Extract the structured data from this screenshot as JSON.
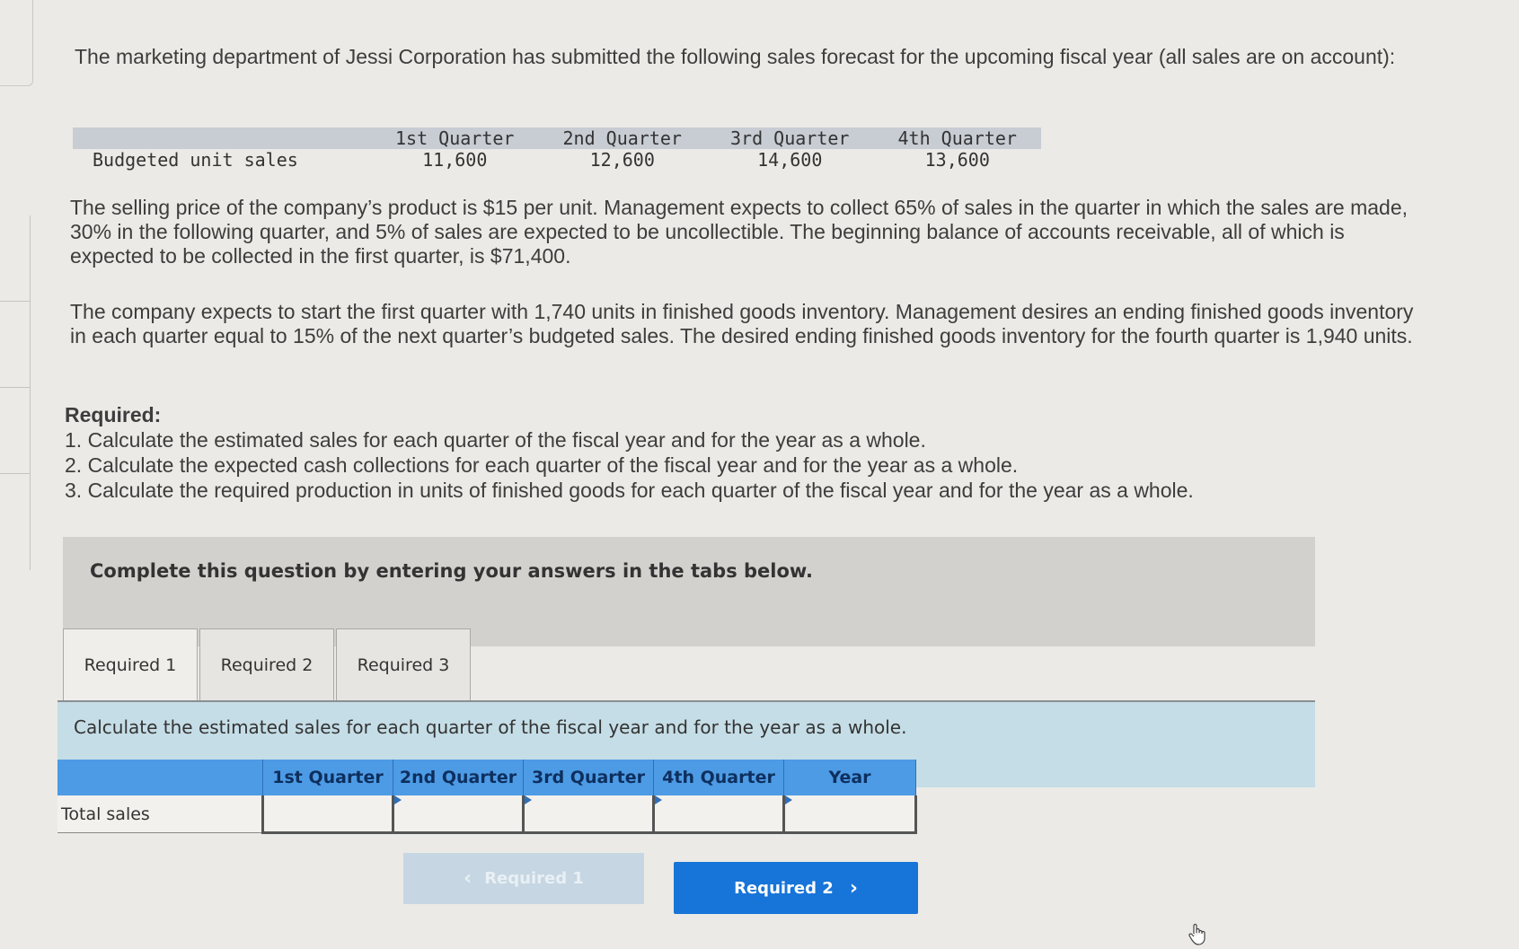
{
  "intro": "The marketing department of Jessi Corporation has submitted the following sales forecast for the upcoming fiscal year (all sales are on account):",
  "forecast": {
    "columns": [
      "1st Quarter",
      "2nd Quarter",
      "3rd Quarter",
      "4th Quarter"
    ],
    "row_label": "Budgeted unit sales",
    "values": [
      "11,600",
      "12,600",
      "14,600",
      "13,600"
    ]
  },
  "paragraphs": [
    "The selling price of the company’s product is $15 per unit. Management expects to collect 65% of sales in the quarter in which the sales are made, 30% in the following quarter, and 5% of sales are expected to be uncollectible. The beginning balance of accounts receivable, all of which is expected to be collected in the first quarter, is $71,400.",
    "The company expects to start the first quarter with 1,740 units in finished goods inventory. Management desires an ending finished goods inventory in each quarter equal to 15% of the next quarter’s budgeted sales. The desired ending finished goods inventory for the fourth quarter is 1,940 units."
  ],
  "required": {
    "heading": "Required:",
    "items": [
      "1. Calculate the estimated sales for each quarter of the fiscal year and for the year as a whole.",
      "2. Calculate the expected cash collections for each quarter of the fiscal year and for the year as a whole.",
      "3. Calculate the required production in units of finished goods for each quarter of the fiscal year and for the year as a whole."
    ]
  },
  "instructions": "Complete this question by entering your answers in the tabs below.",
  "tabs": [
    {
      "label": "Required 1",
      "active": true
    },
    {
      "label": "Required 2",
      "active": false
    },
    {
      "label": "Required 3",
      "active": false
    }
  ],
  "tab_content": {
    "prompt": "Calculate the estimated sales for each quarter of the fiscal year and for the year as a whole.",
    "table": {
      "columns": [
        "1st Quarter",
        "2nd Quarter",
        "3rd Quarter",
        "4th Quarter",
        "Year"
      ],
      "row_label": "Total sales",
      "values": [
        "",
        "",
        "",
        "",
        ""
      ]
    }
  },
  "navigation": {
    "prev_label": "Required 1",
    "next_label": "Required 2",
    "prev_icon": "chevron-left-icon",
    "next_icon": "chevron-right-icon"
  },
  "colors": {
    "header_blue": "#4d9be5",
    "next_button": "#1774d8",
    "prev_button_disabled": "#c6d6e2",
    "tab_panel": "#c5dde6",
    "instruction_box": "#d2d1ce"
  }
}
